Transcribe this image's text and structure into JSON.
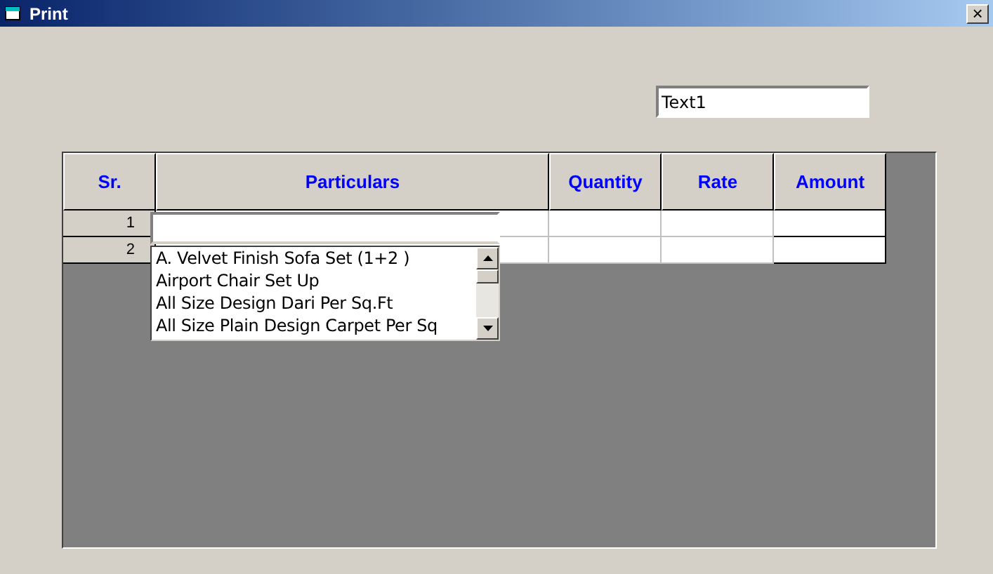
{
  "window": {
    "title": "Print",
    "close": "×"
  },
  "text_field": {
    "value": "Text1"
  },
  "grid": {
    "columns": [
      "Sr.",
      "Particulars",
      "Quantity",
      "Rate",
      "Amount"
    ],
    "rows": [
      {
        "sr": "1"
      },
      {
        "sr": "2"
      }
    ]
  },
  "combo": {
    "items": [
      {
        "label": "A. Velvet Finish Sofa Set (1+2 )"
      },
      {
        "label": "Airport Chair Set Up"
      },
      {
        "label": "All Size Design Dari Per Sq.Ft"
      },
      {
        "label": "All Size Plain Design Carpet Per Sq"
      }
    ]
  }
}
